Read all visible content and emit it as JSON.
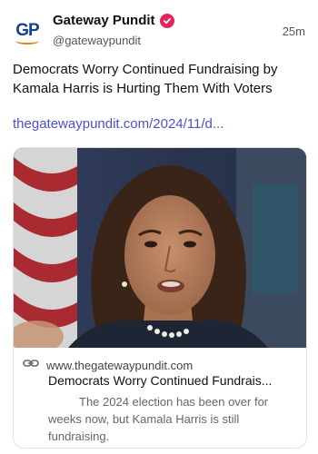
{
  "header": {
    "avatar_text": "GP",
    "display_name": "Gateway Pundit",
    "handle": "@gatewaypundit",
    "timestamp": "25m",
    "verified_icon": "verified-badge-icon",
    "verified_color": "#e0245e"
  },
  "post": {
    "text": "Democrats Worry Continued Fundraising by Kamala Harris is Hurting Them With Voters",
    "link": "thegatewaypundit.com/2024/11/d...",
    "link_color": "#4b4fd6"
  },
  "card": {
    "domain": "www.thegatewaypundit.com",
    "domain_icon": "link-icon",
    "title": "Democrats Worry Continued Fundrais...",
    "description": "The 2024 election has been over for weeks now, but Kamala Harris is still fundraising."
  }
}
